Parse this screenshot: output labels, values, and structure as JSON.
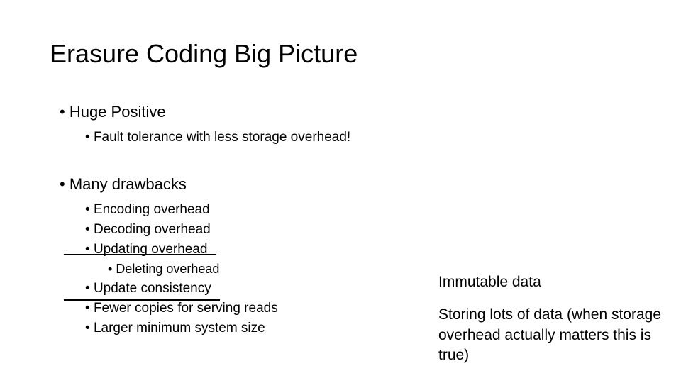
{
  "title": "Erasure Coding Big Picture",
  "bullets": {
    "huge_positive": "Huge Positive",
    "fault_tolerance": "Fault tolerance with less storage overhead!",
    "many_drawbacks": "Many drawbacks",
    "encoding": "Encoding overhead",
    "decoding": "Decoding overhead",
    "updating": "Updating overhead",
    "deleting": "Deleting overhead",
    "update_consistency": "Update consistency",
    "fewer_copies": "Fewer copies for serving reads",
    "larger_min": "Larger minimum system size"
  },
  "notes": {
    "immutable": "Immutable data",
    "storing": "Storing lots of data (when storage overhead actually matters this is true)"
  }
}
